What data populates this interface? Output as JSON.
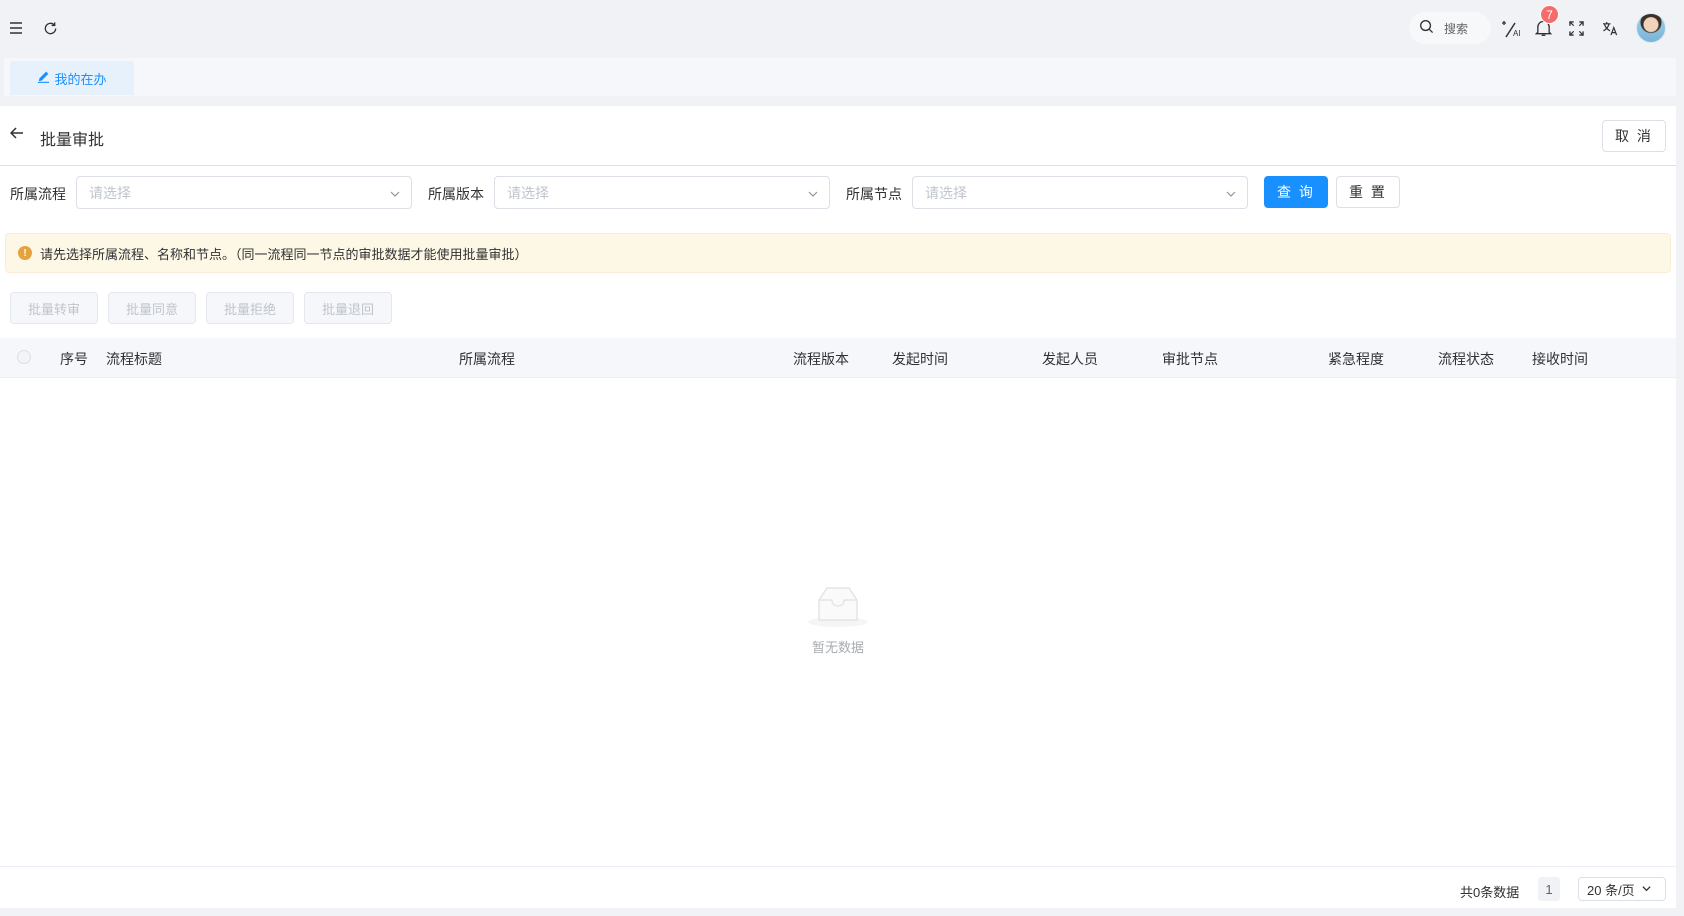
{
  "topbar": {
    "menu_icon": "hamburger-icon",
    "refresh_icon": "refresh-icon",
    "search_label": "搜索",
    "notification_count": "7",
    "icons": [
      "search-icon",
      "ai-magic-icon",
      "bell-icon",
      "fullscreen-icon",
      "translate-icon",
      "avatar"
    ]
  },
  "tabs": [
    {
      "label": "我的在办",
      "icon": "edit-icon",
      "active": true
    }
  ],
  "page": {
    "title": "批量审批",
    "cancel_label": "取 消"
  },
  "filters": {
    "process_label": "所属流程",
    "process_placeholder": "请选择",
    "version_label": "所属版本",
    "version_placeholder": "请选择",
    "node_label": "所属节点",
    "node_placeholder": "请选择",
    "query_label": "查 询",
    "reset_label": "重 置"
  },
  "alert": {
    "text": "请先选择所属流程、名称和节点。（同一流程同一节点的审批数据才能使用批量审批）"
  },
  "batch_actions": [
    "批量转审",
    "批量同意",
    "批量拒绝",
    "批量退回"
  ],
  "table": {
    "columns": [
      "序号",
      "流程标题",
      "所属流程",
      "流程版本",
      "发起时间",
      "发起人员",
      "审批节点",
      "紧急程度",
      "流程状态",
      "接收时间"
    ],
    "rows": [],
    "empty_text": "暂无数据"
  },
  "pagination": {
    "total_text": "共0条数据",
    "current_page": "1",
    "page_size": "20 条/页"
  },
  "colors": {
    "primary": "#1890ff",
    "warning": "#e6a23c",
    "badge": "#f56c6c"
  }
}
